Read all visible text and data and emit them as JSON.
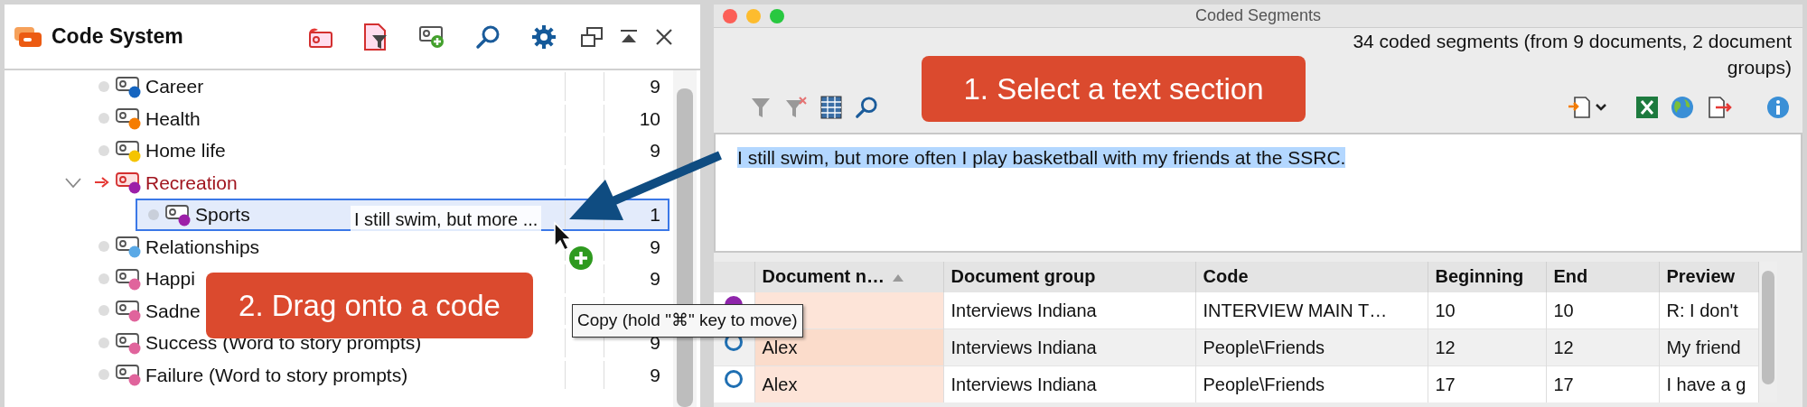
{
  "code_system": {
    "title": "Code System",
    "codes": [
      {
        "name": "Career",
        "count": "9",
        "color": "#1565c0",
        "activated": false,
        "selected": false
      },
      {
        "name": "Health",
        "count": "10",
        "color": "#f57c00",
        "activated": false,
        "selected": false
      },
      {
        "name": "Home life",
        "count": "9",
        "color": "#f5c400",
        "activated": false,
        "selected": false
      },
      {
        "name": "Recreation",
        "color": "#9c1fa8",
        "activated": true,
        "selected": false,
        "expanded": true,
        "children": [
          {
            "name": "Sports",
            "count": "1",
            "color": "#9c1fa8",
            "activated": false,
            "selected": true
          }
        ]
      },
      {
        "name": "Relationships",
        "count": "9",
        "color": "#5aa9e6",
        "activated": false,
        "selected": false
      },
      {
        "name": "Happi",
        "count": "9",
        "color": "#e0649c",
        "activated": false,
        "selected": false
      },
      {
        "name": "Sadne",
        "color": "#e0649c",
        "activated": false,
        "selected": false
      },
      {
        "name": "Success (Word to story prompts)",
        "count": "9",
        "color": "#e0649c",
        "activated": false,
        "selected": false
      },
      {
        "name": "Failure (Word to story prompts)",
        "count": "9",
        "color": "#e0649c",
        "activated": false,
        "selected": false
      }
    ]
  },
  "drag": {
    "ghost_text": "I still swim, but more ...",
    "tooltip": "Copy (hold \"⌘\" key to move)"
  },
  "coded_segments": {
    "title": "Coded Segments",
    "summary_lines": [
      "34 coded segments (from 9 documents, 2 document",
      "groups)"
    ],
    "segment_text": "I still swim, but more often I play basketball with my friends at the SSRC.",
    "columns": [
      {
        "label": "Document n…",
        "sorted": true
      },
      {
        "label": "Document group",
        "sorted": false
      },
      {
        "label": "Code",
        "sorted": false
      },
      {
        "label": "Beginning",
        "sorted": false
      },
      {
        "label": "End",
        "sorted": false
      },
      {
        "label": "Preview",
        "sorted": false
      }
    ],
    "rows": [
      {
        "kind": "dot",
        "color": "#8e24aa",
        "document_group": "Interviews Indiana",
        "code": "INTERVIEW MAIN T…",
        "beginning": "10",
        "end": "10",
        "preview": "R: I don't"
      },
      {
        "kind": "ring",
        "color": "#1f6fb2",
        "document_name": "Alex",
        "document_group": "Interviews Indiana",
        "code": "People\\Friends",
        "beginning": "12",
        "end": "12",
        "preview": "My friend"
      },
      {
        "kind": "ring",
        "color": "#1f6fb2",
        "document_name": "Alex",
        "document_group": "Interviews Indiana",
        "code": "People\\Friends",
        "beginning": "17",
        "end": "17",
        "preview": "I have a g"
      }
    ]
  },
  "callouts": [
    {
      "text": "1. Select a text section"
    },
    {
      "text": "2. Drag onto a code"
    }
  ]
}
